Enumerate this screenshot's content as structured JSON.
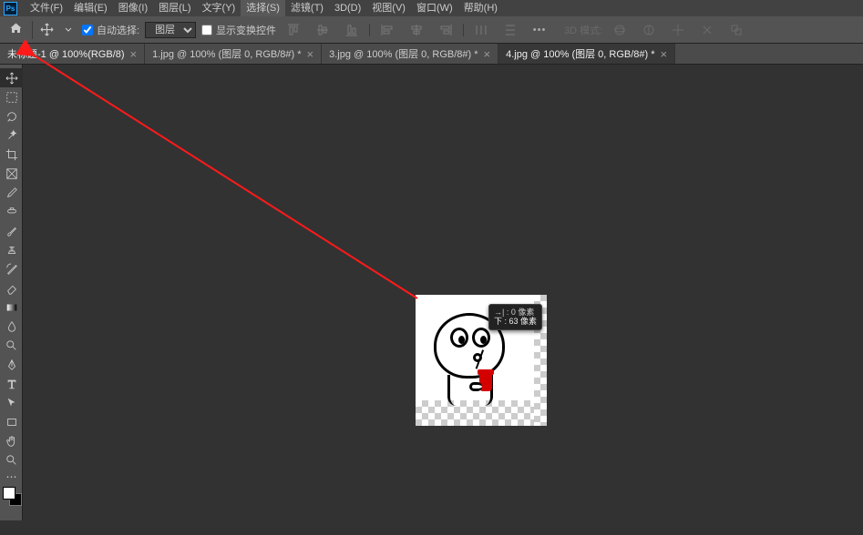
{
  "menubar": {
    "items": [
      "文件(F)",
      "编辑(E)",
      "图像(I)",
      "图层(L)",
      "文字(Y)",
      "选择(S)",
      "滤镜(T)",
      "3D(D)",
      "视图(V)",
      "窗口(W)",
      "帮助(H)"
    ]
  },
  "optionsbar": {
    "auto_select_label": "自动选择:",
    "layer_select_value": "图层",
    "show_transform_label": "显示变换控件",
    "show_transform_checked": false,
    "mode3d_label": "3D 模式:"
  },
  "tabs": [
    {
      "label": "未标题-1 @ 100%(RGB/8)",
      "active": false,
      "highlight": true
    },
    {
      "label": "1.jpg @ 100% (图层 0, RGB/8#) *",
      "active": false
    },
    {
      "label": "3.jpg @ 100% (图层 0, RGB/8#) *",
      "active": false
    },
    {
      "label": "4.jpg @ 100% (图层 0, RGB/8#) *",
      "active": true
    }
  ],
  "tab_close_glyph": "×",
  "info_tooltip": {
    "line1": "→| :  0 像素",
    "line2": "下 : 63 像素"
  },
  "tools": [
    "move",
    "marquee",
    "lasso",
    "magic-wand",
    "crop",
    "frame",
    "eyedropper",
    "spot-heal",
    "brush",
    "clone",
    "history-brush",
    "eraser",
    "gradient",
    "blur",
    "dodge",
    "pen",
    "type",
    "path-select",
    "rectangle",
    "hand",
    "zoom",
    "edit-toolbar"
  ],
  "colors": {
    "accent_arrow": "#ff1a1a",
    "cup_red": "#d40000"
  }
}
